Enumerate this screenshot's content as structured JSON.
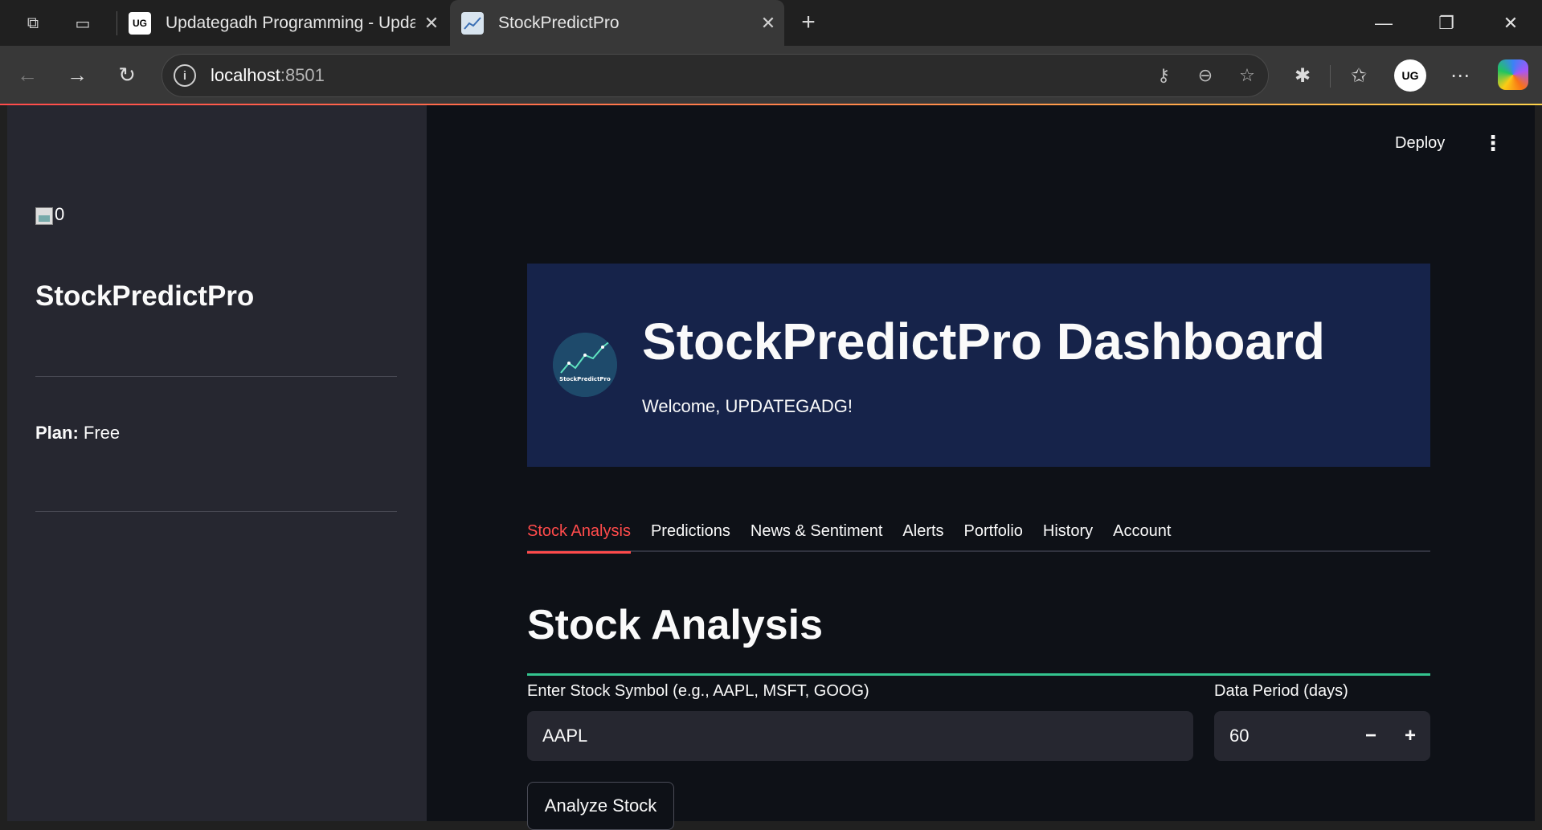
{
  "browser": {
    "tabs": [
      {
        "title": "Updategadh Programming - Upda",
        "favicon": "UG"
      },
      {
        "title": "StockPredictPro",
        "favicon": "chart-icon"
      }
    ],
    "url_host": "localhost",
    "url_port": ":8501",
    "profile_initials": "UG"
  },
  "sidebar": {
    "logo_alt": "0",
    "title": "StockPredictPro",
    "plan_label": "Plan:",
    "plan_value": "Free"
  },
  "header": {
    "deploy_label": "Deploy"
  },
  "hero": {
    "logo_text": "StockPredictPro",
    "title": "StockPredictPro Dashboard",
    "welcome": "Welcome, UPDATEGADG!"
  },
  "tabs": [
    "Stock Analysis",
    "Predictions",
    "News & Sentiment",
    "Alerts",
    "Portfolio",
    "History",
    "Account"
  ],
  "analysis": {
    "heading": "Stock Analysis",
    "symbol_label": "Enter Stock Symbol (e.g., AAPL, MSFT, GOOG)",
    "symbol_value": "AAPL",
    "period_label": "Data Period (days)",
    "period_value": "60",
    "minus": "−",
    "plus": "+",
    "analyze_label": "Analyze Stock"
  },
  "colors": {
    "accent_red": "#ff4b4b",
    "accent_green": "#34c48f",
    "hero_bg": "#16234a",
    "sidebar_bg": "#262730",
    "app_bg": "#0e1117"
  }
}
